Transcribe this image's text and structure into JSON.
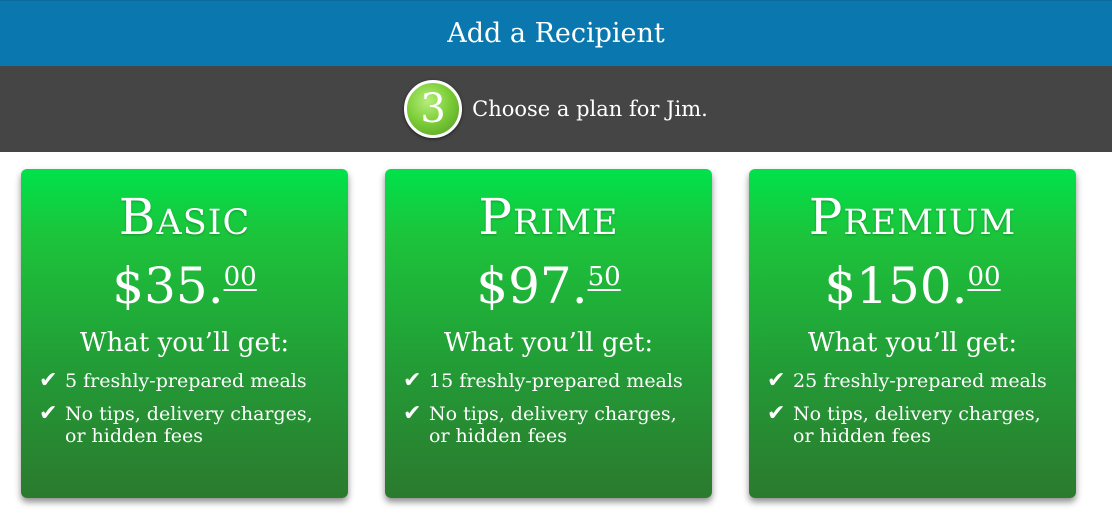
{
  "header": {
    "title": "Add a Recipient"
  },
  "step": {
    "number": "3",
    "text": "Choose a plan for Jim."
  },
  "check_icon": "✔",
  "plans": [
    {
      "name": "Basic",
      "price_main": "$35.",
      "price_cents": "00",
      "get_label": "What you’ll get:",
      "features": [
        "5 freshly-prepared meals",
        "No tips, delivery charges, or hidden fees"
      ]
    },
    {
      "name": "Prime",
      "price_main": "$97.",
      "price_cents": "50",
      "get_label": "What you’ll get:",
      "features": [
        "15 freshly-prepared meals",
        "No tips, delivery charges, or hidden fees"
      ]
    },
    {
      "name": "Premium",
      "price_main": "$150.",
      "price_cents": "00",
      "get_label": "What you’ll get:",
      "features": [
        "25 freshly-prepared meals",
        "No tips, delivery charges, or hidden fees"
      ]
    }
  ],
  "colors": {
    "header_bg": "#0a78ae",
    "step_bar_bg": "#454545",
    "card_top": "#00e24b",
    "card_bottom": "#2b7a2e",
    "badge": "#7fcf3b"
  }
}
